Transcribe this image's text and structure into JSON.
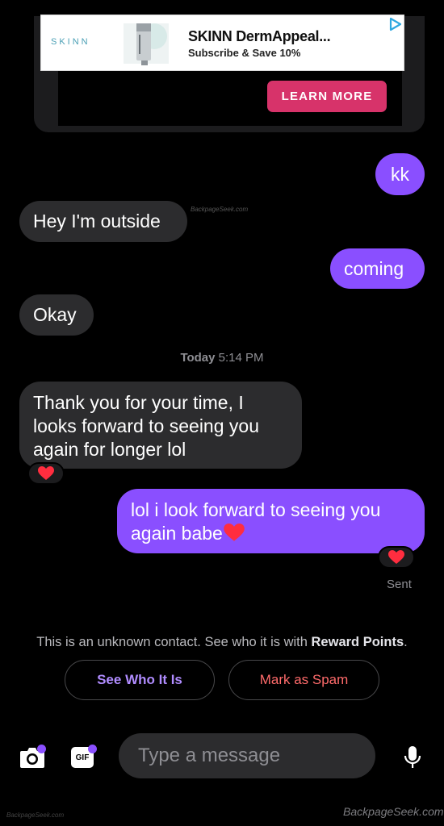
{
  "ad": {
    "brand": "SKINN",
    "title": "SKINN DermAppeal...",
    "subtitle": "Subscribe & Save 10%",
    "cta": "LEARN MORE"
  },
  "watermark": {
    "inline": "BackpageSeek.com",
    "footer": "BackpageSeek.com",
    "corner": "BackpageSeek.com"
  },
  "messages": [
    {
      "direction": "outgoing",
      "text": "kk"
    },
    {
      "direction": "incoming",
      "text": "Hey I'm outside"
    },
    {
      "direction": "outgoing",
      "text": "coming"
    },
    {
      "direction": "incoming",
      "text": "Okay"
    },
    {
      "direction": "incoming",
      "text": "Thank you for your time, I looks forward to seeing you again for longer lol",
      "reaction": "heart"
    },
    {
      "direction": "outgoing",
      "text": "lol i look forward to seeing you again babe",
      "reaction": "heart"
    }
  ],
  "timestamp": {
    "day": "Today",
    "time": "5:14 PM"
  },
  "status": "Sent",
  "notice": {
    "text": "This is an unknown contact. See who it is with ",
    "highlight": "Reward Points",
    "end": "."
  },
  "actions": {
    "see_who": "See Who It Is",
    "mark_spam": "Mark as Spam"
  },
  "composer": {
    "placeholder": "Type a message",
    "gif_label": "GIF"
  },
  "colors": {
    "outgoing_bubble": "#8a4fff",
    "incoming_bubble": "#2c2c2e",
    "cta": "#d7336a",
    "spam": "#ff6b6b",
    "see_who": "#b08cff"
  },
  "icons": [
    "camera-icon",
    "gif-icon",
    "microphone-icon",
    "heart-icon",
    "ad-choices-icon"
  ]
}
